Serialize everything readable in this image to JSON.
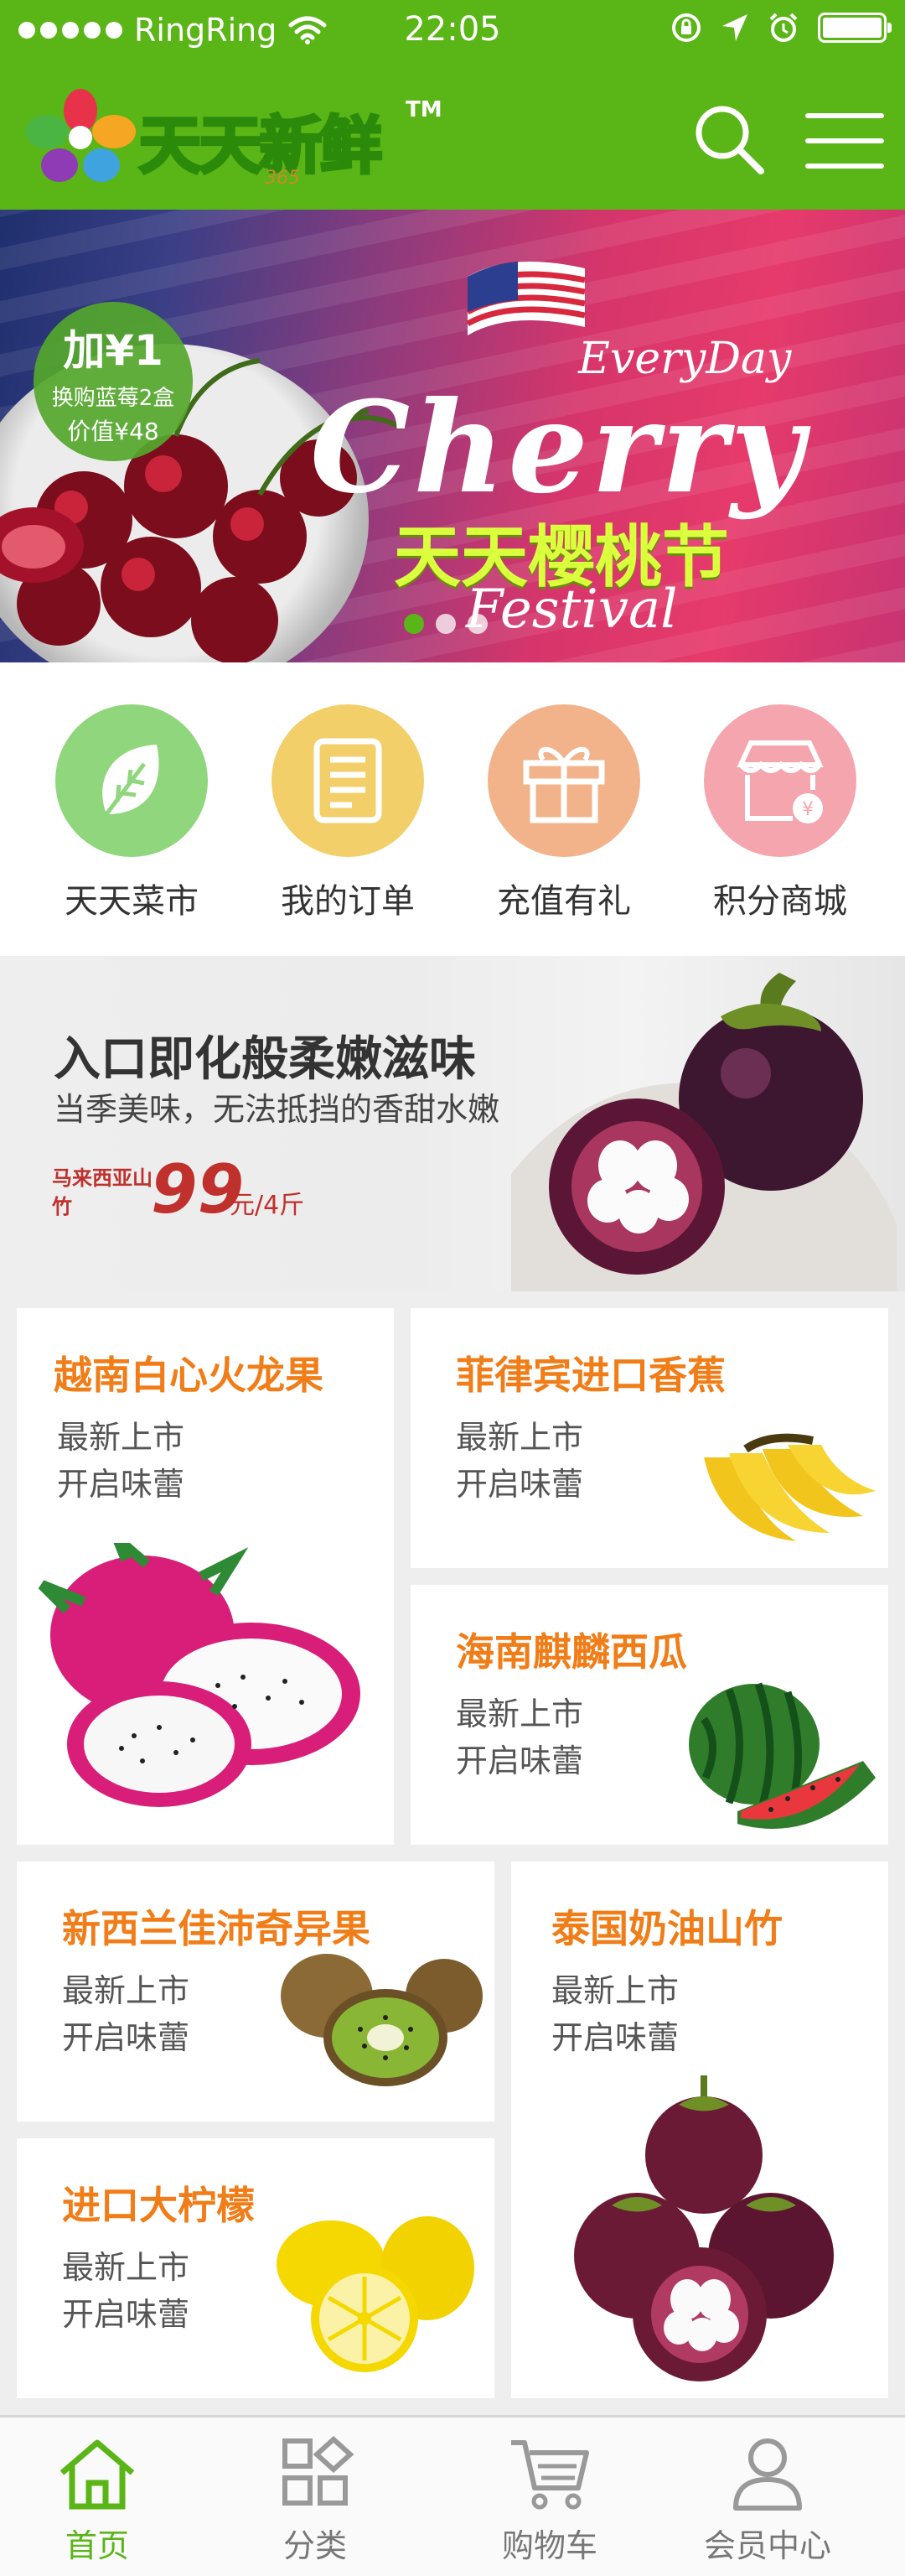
{
  "status_bar": {
    "carrier": "RingRing",
    "time": "22:05"
  },
  "header": {
    "logo_text": "天天新鲜",
    "logo_sub": "365",
    "trademark": "TM",
    "icons": [
      "search-icon",
      "menu-icon"
    ]
  },
  "banner": {
    "badge_big": "加¥1",
    "badge_line1": "换购蓝莓2盒",
    "badge_line2": "价值¥48",
    "everyday": "EveryDay",
    "cherry": "Cherry",
    "title_cn": "天天樱桃节",
    "festival": "Festival",
    "pages": 3,
    "active_page": 1
  },
  "quick_nav": [
    {
      "label": "天天菜市",
      "icon": "leaf-icon",
      "color": "#8fd67c"
    },
    {
      "label": "我的订单",
      "icon": "order-list-icon",
      "color": "#f3cf6a"
    },
    {
      "label": "充值有礼",
      "icon": "gift-icon",
      "color": "#f2b38a"
    },
    {
      "label": "积分商城",
      "icon": "store-icon",
      "color": "#f5a5ad"
    }
  ],
  "promo": {
    "title": "入口即化般柔嫩滋味",
    "subtitle": "当季美味，无法抵挡的香甜水嫩",
    "origin": "马来西亚山竹",
    "price": "99",
    "unit": "元/4斤"
  },
  "products": [
    {
      "title": "越南白心火龙果",
      "line1": "最新上市",
      "line2": "开启味蕾"
    },
    {
      "title": "菲律宾进口香蕉",
      "line1": "最新上市",
      "line2": "开启味蕾"
    },
    {
      "title": "海南麒麟西瓜",
      "line1": "最新上市",
      "line2": "开启味蕾"
    },
    {
      "title": "新西兰佳沛奇异果",
      "line1": "最新上市",
      "line2": "开启味蕾"
    },
    {
      "title": "泰国奶油山竹",
      "line1": "最新上市",
      "line2": "开启味蕾"
    },
    {
      "title": "进口大柠檬",
      "line1": "最新上市",
      "line2": "开启味蕾"
    }
  ],
  "tab_bar": [
    {
      "label": "首页",
      "icon": "home-icon",
      "active": true
    },
    {
      "label": "分类",
      "icon": "category-icon",
      "active": false
    },
    {
      "label": "购物车",
      "icon": "cart-icon",
      "active": false
    },
    {
      "label": "会员中心",
      "icon": "user-icon",
      "active": false
    }
  ],
  "colors": {
    "brand_green": "#5ab516",
    "accent_orange": "#f07d18",
    "price_red": "#c0302c"
  }
}
